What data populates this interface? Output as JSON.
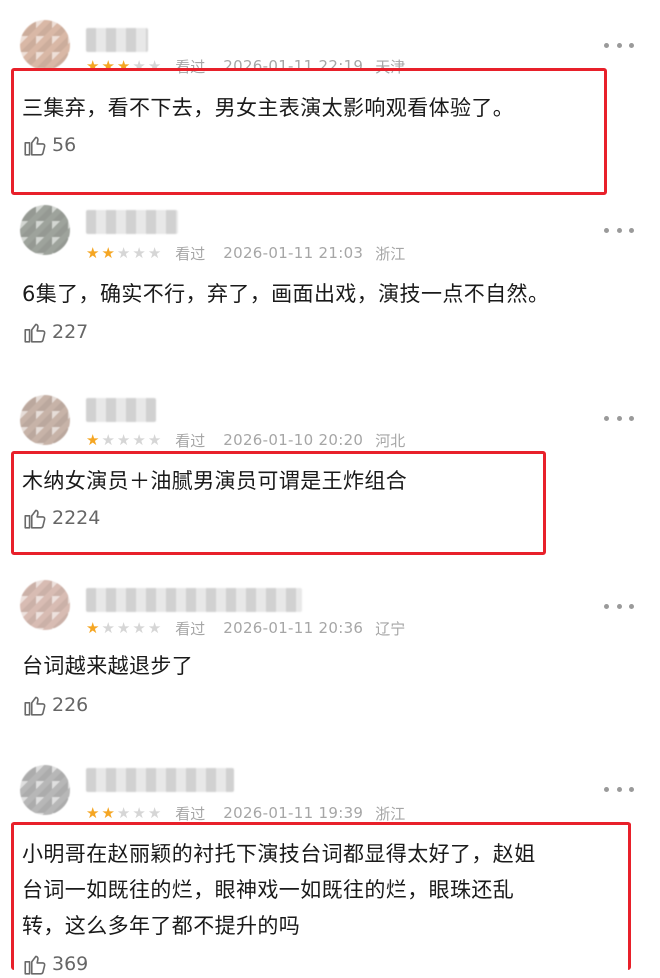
{
  "comments": [
    {
      "rating": 3,
      "seen": "看过",
      "time": "2026-01-11 22:19",
      "region": "天津",
      "text_lines": [
        "三集弃，看不下去，男女主表演太影响观看体验了。"
      ],
      "likes": "56",
      "highlighted": true
    },
    {
      "rating": 2,
      "seen": "看过",
      "time": "2026-01-11 21:03",
      "region": "浙江",
      "text_lines": [
        "6集了，确实不行，弃了，画面出戏，演技一点不自然。"
      ],
      "likes": "227",
      "highlighted": false
    },
    {
      "rating": 1,
      "seen": "看过",
      "time": "2026-01-10 20:20",
      "region": "河北",
      "text_lines": [
        "木纳女演员＋油腻男演员可谓是王炸组合"
      ],
      "likes": "2224",
      "highlighted": true
    },
    {
      "rating": 1,
      "seen": "看过",
      "time": "2026-01-11 20:36",
      "region": "辽宁",
      "text_lines": [
        "台词越来越退步了"
      ],
      "likes": "226",
      "highlighted": false
    },
    {
      "rating": 2,
      "seen": "看过",
      "time": "2026-01-11 19:39",
      "region": "浙江",
      "text_lines": [
        "小明哥在赵丽颖的衬托下演技台词都显得太好了，赵姐",
        "台词一如既往的烂，眼神戏一如既往的烂，眼珠还乱",
        "转，这么多年了都不提升的吗"
      ],
      "likes": "369",
      "highlighted": true
    }
  ],
  "colors": {
    "star_on": "#f5a623",
    "star_off": "#d6d6d6",
    "highlight_box": "#e8202a",
    "meta_text": "#a6a6a6"
  },
  "icons": {
    "like": "thumbs-up-icon",
    "more": "more-dots-icon"
  }
}
